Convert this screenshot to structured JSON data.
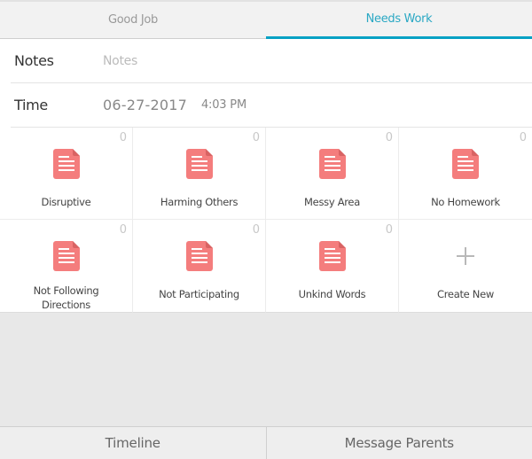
{
  "tabs": [
    {
      "label": "Good Job",
      "active": false
    },
    {
      "label": "Needs Work",
      "active": true
    }
  ],
  "form": {
    "notes": {
      "label": "Notes",
      "value": "",
      "placeholder": "Notes"
    },
    "time": {
      "label": "Time",
      "date": "06-27-2017",
      "time": "4:03 PM"
    }
  },
  "behaviors": [
    {
      "label": "Disruptive",
      "count": "0",
      "icon": "document-icon"
    },
    {
      "label": "Harming Others",
      "count": "0",
      "icon": "document-icon"
    },
    {
      "label": "Messy Area",
      "count": "0",
      "icon": "document-icon"
    },
    {
      "label": "No Homework",
      "count": "0",
      "icon": "document-icon"
    },
    {
      "label": "Not Following Directions",
      "count": "0",
      "icon": "document-icon"
    },
    {
      "label": "Not Participating",
      "count": "0",
      "icon": "document-icon"
    },
    {
      "label": "Unkind Words",
      "count": "0",
      "icon": "document-icon"
    }
  ],
  "create_new": {
    "label": "Create New",
    "icon": "plus-icon"
  },
  "bottom_bar": {
    "timeline": "Timeline",
    "message_parents": "Message Parents"
  },
  "colors": {
    "accent": "#05a1c4",
    "icon": "#f47d7d"
  }
}
